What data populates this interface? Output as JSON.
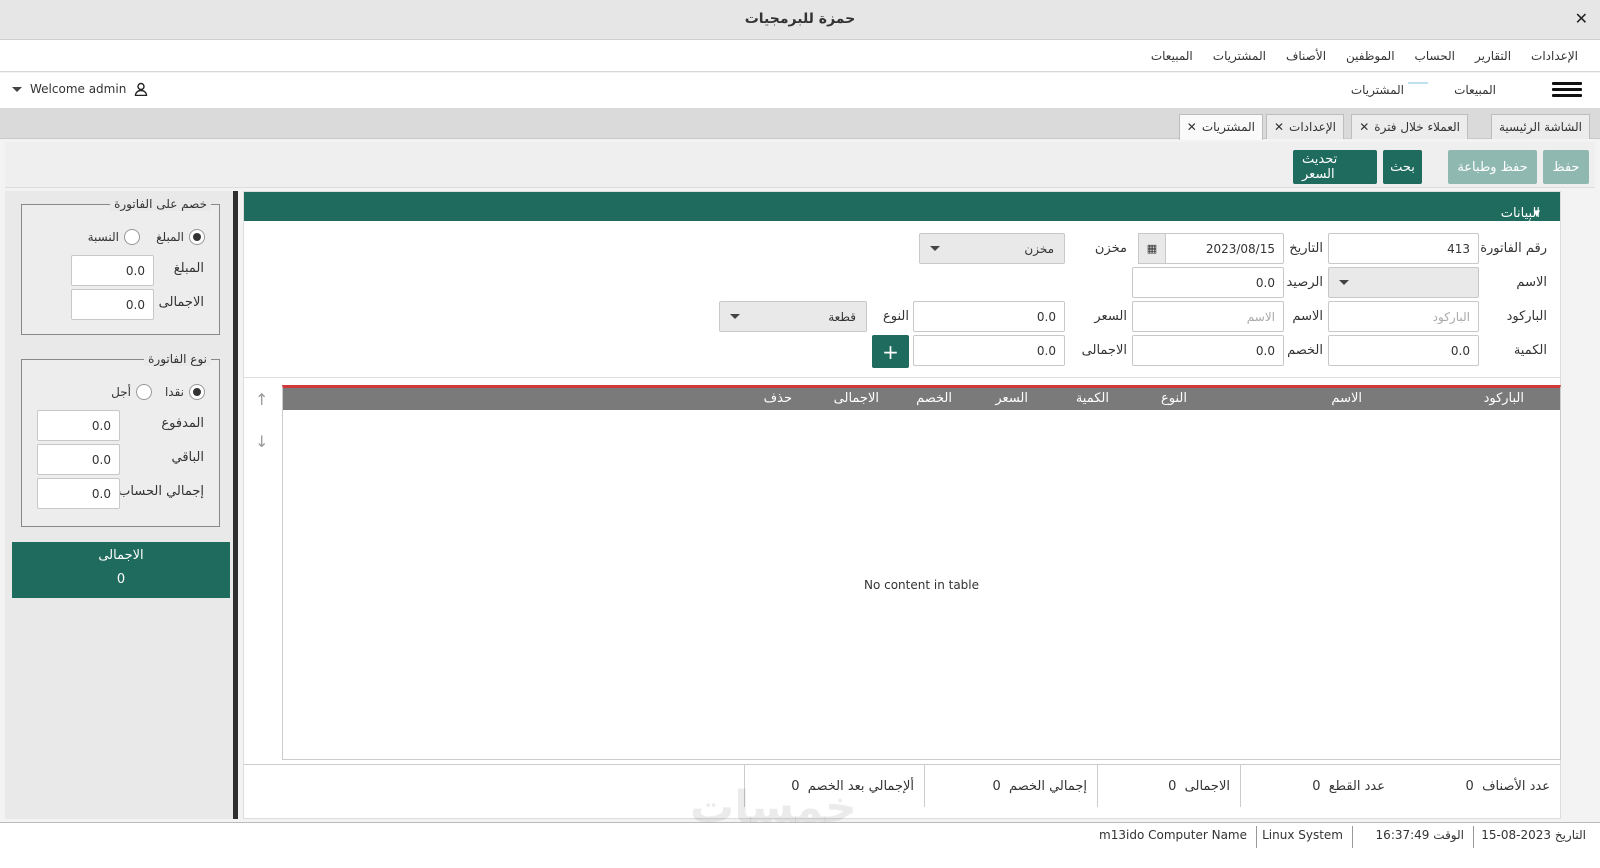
{
  "window": {
    "title": "حمزة للبرمجيات",
    "close": "✕"
  },
  "menu": {
    "items": [
      "المبيعات",
      "المشتريات",
      "الأصناف",
      "الموظفين",
      "الحساب",
      "التقارير",
      "الإعدادات"
    ]
  },
  "toolbar": {
    "nav_sales": "المبيعات",
    "nav_purchases": "المشتريات",
    "welcome": "Welcome admin"
  },
  "tabs": [
    {
      "label": "الشاشة الرئيسية",
      "closable": false
    },
    {
      "label": "العملاء خلال فترة",
      "closable": true
    },
    {
      "label": "الإعدادات",
      "closable": true
    },
    {
      "label": "المشتريات",
      "closable": true,
      "active": true
    }
  ],
  "actions": {
    "save": "حفظ",
    "save_print": "حفظ وطباعة",
    "search": "بحث",
    "update_price": "تحديث السعر"
  },
  "sidebar": {
    "discount": {
      "legend": "خصم على الفاتورة",
      "radio_amount": "المبلغ",
      "radio_percent": "النسبة",
      "amount_label": "المبلغ",
      "amount_value": "0.0",
      "total_label": "الاجمالى",
      "total_value": "0.0"
    },
    "invoice_type": {
      "legend": "نوع الفاتورة",
      "radio_cash": "نقدا",
      "radio_credit": "أجل",
      "paid_label": "المدفوع",
      "paid_value": "0.0",
      "remaining_label": "الباقي",
      "remaining_value": "0.0",
      "account_total_label": "إجمالي الحساب",
      "account_total_value": "0.0"
    },
    "total": {
      "label": "الاجمالى",
      "value": "0"
    }
  },
  "form": {
    "section_title": "البيانات الأساسية",
    "invoice_no_label": "رقم الفاتورة",
    "invoice_no": "413",
    "date_label": "التاريخ",
    "date": "2023/08/15",
    "store_label": "مخزن",
    "store_value": "مخزن",
    "name_label": "الاسم",
    "balance_label": "الرصيد",
    "balance": "0.0",
    "barcode_label": "الباركود",
    "barcode_placeholder": "الباركود",
    "item_name_label": "الاسم",
    "item_name_placeholder": "الاسم",
    "price_label": "السعر",
    "price": "0.0",
    "type_label": "النوع",
    "type_value": "قطعة",
    "qty_label": "الكمية",
    "qty": "0.0",
    "discount_label": "الخصم",
    "discount": "0.0",
    "total_label": "الاجمالى",
    "total": "0.0",
    "add": "+"
  },
  "table": {
    "columns": [
      "الباركود",
      "الاسم",
      "النوع",
      "الكمية",
      "السعر",
      "الخصم",
      "الاجمالى",
      "حذف"
    ],
    "empty": "No content in table"
  },
  "footer": {
    "items_count_label": "عدد الأصناف",
    "items_count": "0",
    "pieces_count_label": "عدد القطع",
    "pieces_count": "0",
    "total_label": "الاجمالى",
    "total": "0",
    "discount_total_label": "إجمالي الخصم",
    "discount_total": "0",
    "after_discount_label": "ألإجمالي بعد الخصم",
    "after_discount": "0"
  },
  "statusbar": {
    "date_label": "التاريخ",
    "date": "2023-08-15",
    "time_label": "الوقت",
    "time": "16:37:49",
    "os": "Linux System",
    "computer_label": "Computer Name",
    "computer": "m13ido"
  },
  "watermark": "خمسات"
}
